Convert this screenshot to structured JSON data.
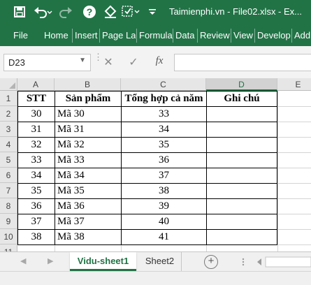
{
  "window": {
    "title": "Taimienphi.vn - File02.xlsx - Ex...",
    "accent": "#217346"
  },
  "quick_access": {
    "icons": [
      "save-icon",
      "undo-icon",
      "redo-icon",
      "help-icon",
      "paint-bucket-icon",
      "format-icon",
      "customize-icon"
    ]
  },
  "ribbon": {
    "tabs": [
      "File",
      "Home",
      "Insert",
      "Page Lay",
      "Formula",
      "Data",
      "Review",
      "View",
      "Develop",
      "Add"
    ]
  },
  "formula_bar": {
    "name_box": "D23",
    "fx_label": "fx",
    "formula_value": ""
  },
  "sheet": {
    "columns": [
      "A",
      "B",
      "C",
      "D",
      "E"
    ],
    "rows": [
      "1",
      "2",
      "3",
      "4",
      "5",
      "6",
      "7",
      "8",
      "9",
      "10",
      "11"
    ],
    "selected_cell": "D23",
    "headers": [
      "STT",
      "Sản phẩm",
      "Tổng hợp cả năm",
      "Ghi chú"
    ],
    "data": [
      [
        "30",
        "Mã 30",
        "33",
        ""
      ],
      [
        "31",
        "Mã 31",
        "34",
        ""
      ],
      [
        "32",
        "Mã 32",
        "35",
        ""
      ],
      [
        "33",
        "Mã 33",
        "36",
        ""
      ],
      [
        "34",
        "Mã 34",
        "37",
        ""
      ],
      [
        "35",
        "Mã 35",
        "38",
        ""
      ],
      [
        "36",
        "Mã 36",
        "39",
        ""
      ],
      [
        "37",
        "Mã 37",
        "40",
        ""
      ],
      [
        "38",
        "Mã 38",
        "41",
        ""
      ]
    ]
  },
  "sheet_tabs": {
    "tabs": [
      "Vidu-sheet1",
      "Sheet2"
    ],
    "active": "Vidu-sheet1",
    "add_label": "+"
  }
}
